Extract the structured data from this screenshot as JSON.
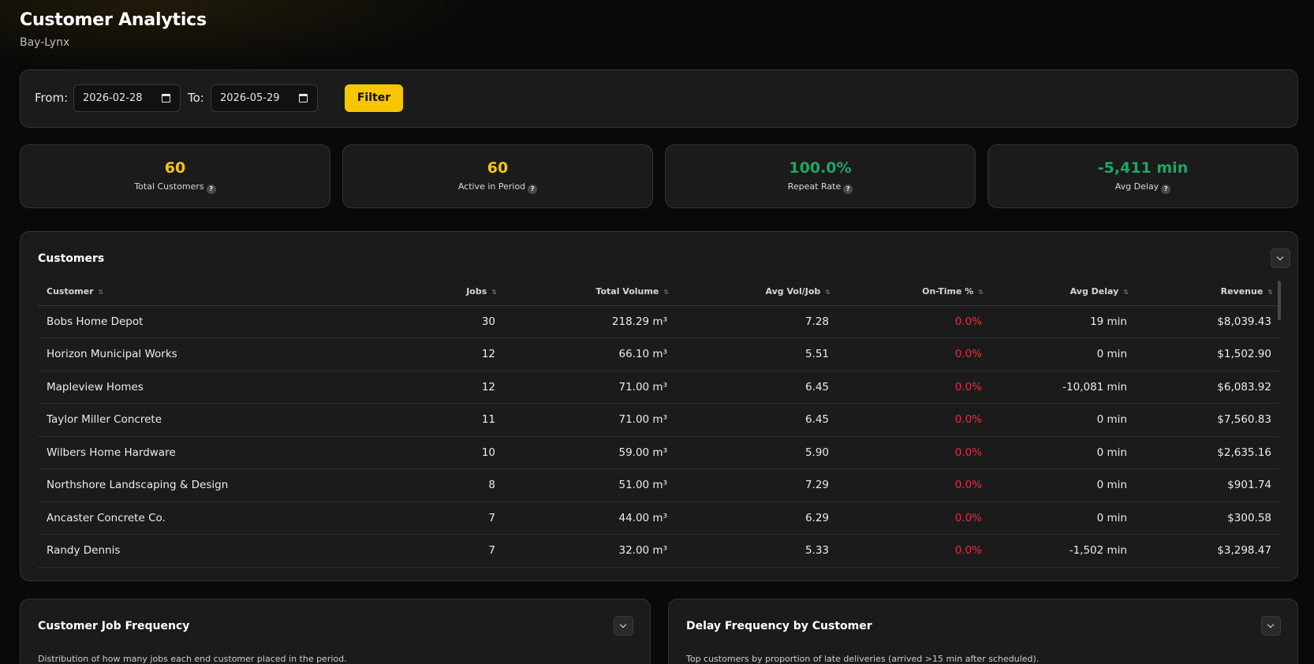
{
  "header": {
    "title": "Customer Analytics",
    "subtitle": "Bay-Lynx"
  },
  "filter": {
    "from_label": "From:",
    "from_value": "2026-02-28",
    "to_label": "To:",
    "to_value": "2026-05-29",
    "button_label": "Filter"
  },
  "stats": [
    {
      "value": "60",
      "label": "Total Customers",
      "color": "#f5c518"
    },
    {
      "value": "60",
      "label": "Active in Period",
      "color": "#f5c518"
    },
    {
      "value": "100.0%",
      "label": "Repeat Rate",
      "color": "#21a464"
    },
    {
      "value": "-5,411 min",
      "label": "Avg Delay",
      "color": "#21a464"
    }
  ],
  "customers": {
    "title": "Customers",
    "columns": [
      "Customer",
      "Jobs",
      "Total Volume",
      "Avg Vol/Job",
      "On-Time %",
      "Avg Delay",
      "Revenue"
    ],
    "rows": [
      [
        "Bobs Home Depot",
        "30",
        "218.29 m³",
        "7.28",
        "0.0%",
        "19 min",
        "$8,039.43"
      ],
      [
        "Horizon Municipal Works",
        "12",
        "66.10 m³",
        "5.51",
        "0.0%",
        "0 min",
        "$1,502.90"
      ],
      [
        "Mapleview Homes",
        "12",
        "71.00 m³",
        "6.45",
        "0.0%",
        "-10,081 min",
        "$6,083.92"
      ],
      [
        "Taylor Miller Concrete",
        "11",
        "71.00 m³",
        "6.45",
        "0.0%",
        "0 min",
        "$7,560.83"
      ],
      [
        "Wilbers Home Hardware",
        "10",
        "59.00 m³",
        "5.90",
        "0.0%",
        "0 min",
        "$2,635.16"
      ],
      [
        "Northshore Landscaping & Design",
        "8",
        "51.00 m³",
        "7.29",
        "0.0%",
        "0 min",
        "$901.74"
      ],
      [
        "Ancaster Concrete Co.",
        "7",
        "44.00 m³",
        "6.29",
        "0.0%",
        "0 min",
        "$300.58"
      ],
      [
        "Randy Dennis",
        "7",
        "32.00 m³",
        "5.33",
        "0.0%",
        "-1,502 min",
        "$3,298.47"
      ]
    ]
  },
  "job_frequency": {
    "title": "Customer Job Frequency",
    "description": "Distribution of how many jobs each end customer placed in the period."
  },
  "delay_frequency": {
    "title": "Delay Frequency by Customer",
    "description": "Top customers by proportion of late deliveries (arrived >15 min after scheduled)."
  }
}
